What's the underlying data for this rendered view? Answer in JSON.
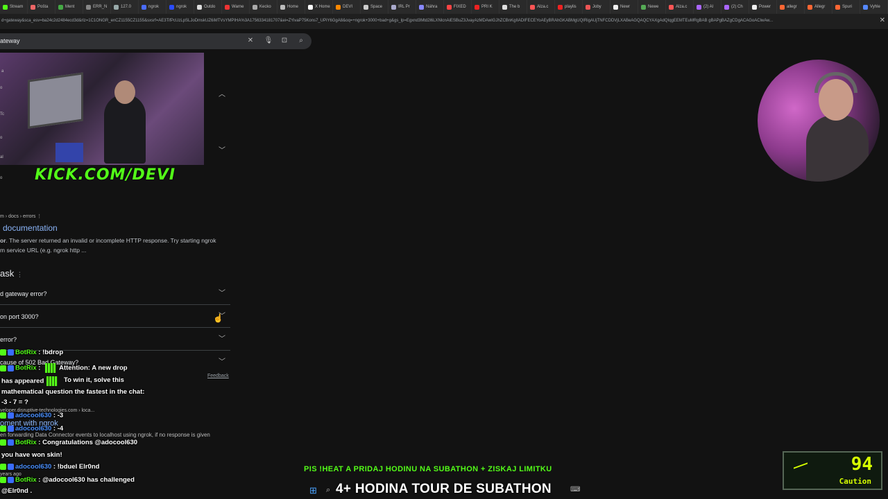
{
  "browser": {
    "tabs": [
      "Stream",
      "Pošta",
      "Ment",
      "ERR_N",
      "127.0",
      "ngrok",
      "ngrok",
      "Outdo",
      "Warne",
      "Kecko",
      "Home",
      "X Home",
      "DEVI",
      "Space",
      "IRL Pr",
      "Náhra",
      "FIXED",
      "PRI K",
      "The b",
      "Alza.c",
      "playlis",
      "Joby",
      "Newr",
      "Newe",
      "Alza.c",
      "(2) Al",
      "(2) Ch",
      "Power",
      "allegr",
      "Allegr",
      "Spuri",
      "Vyhle"
    ],
    "tab_colors": [
      "#53fc18",
      "#e66",
      "#44aa44",
      "#888",
      "#9aa",
      "#4a6cff",
      "#2a4cff",
      "#ddd",
      "#e33",
      "#aaa",
      "#bbb",
      "#fff",
      "#f80",
      "#ccc",
      "#aac",
      "#88f",
      "#f44",
      "#e22",
      "#ddd",
      "#f55",
      "#e22",
      "#e55",
      "#eee",
      "#5a5",
      "#f55",
      "#a6f",
      "#a6f",
      "#eee",
      "#f63",
      "#f63",
      "#f63",
      "#58f"
    ],
    "url": "d+gateway&sca_esv=ba24c2d2484ecd3d&rlz=1C1ONGR_enCZ1155CZ1155&sxsrf=AE3TifPcUzLpSLJoDmskUZ6iMTVsYMPIHA%3A1756334181707&ei=ZYivaP75Kons7_UPiY6GgA8&oq=+ngrok+3000+bad+g&gs_lp=Egxnd3Mtd2l6LXNlcnAiESBuZ3JvayAzMDAwIGJhZCBnKgIIADIFECEYoAEyBRAhGKABMgUQIRigAUjTNFCDDVjLXABeAGQAQCYAXgAdQIqgEEMTEuMRgBAB gBAPgBAZgCDgACAGoAClwAw..."
  },
  "search": {
    "query": "ateway"
  },
  "overlay": {
    "kick_logo": "KICK.COM/DEVI",
    "left_fragments": [
      "a",
      "o",
      "Tc",
      "o",
      "al",
      "o"
    ],
    "ticker": "PIS !HEAT A PRIDAJ HODINU NA SUBATHON + ZISKAJ LIMITKU",
    "banner": "4+ HODINA TOUR DE SUBATHON",
    "meter_value": "94",
    "meter_label": "Caution"
  },
  "result": {
    "breadcrumb": "m › docs › errors",
    "title": "documentation",
    "snippet_bold": "or",
    "snippet_1": ". The server returned an invalid or incomplete HTTP response. Try starting ngrok",
    "snippet_2": "m service URL (e.g. ngrok http ..."
  },
  "paa": {
    "heading": "ask",
    "questions": [
      "d gateway error?",
      "on port 3000?",
      "error?",
      "cause of 502 Bad Gateway?"
    ]
  },
  "feedback": "Feedback",
  "underlay": {
    "site": "veloper.disruptive-technologies.com › loca...",
    "title_frag": "oment with ngrok",
    "snippet": "en forwarding Data Connector events to localhost using ngrok, if no response is given",
    "time": "years ago"
  },
  "chat": [
    {
      "user": "BotRix",
      "sep": " : ",
      "msg": "!bdrop"
    },
    {
      "user": "BotRix",
      "sep": " : ",
      "msg": "Attention: A new drop"
    },
    {
      "user": "",
      "sep": "",
      "msg": "has appeared"
    },
    {
      "user": "",
      "sep": "",
      "msg": "To win it, solve this"
    },
    {
      "user": "",
      "sep": "",
      "msg": "mathematical question the fastest in the chat:"
    },
    {
      "user": "",
      "sep": "",
      "msg": "-3 - 7 = ?"
    },
    {
      "user": "adocool630",
      "sep": " : ",
      "msg": "-3"
    },
    {
      "user": "adocool630",
      "sep": " : ",
      "msg": "-4"
    },
    {
      "user": "BotRix",
      "sep": " : ",
      "msg": "Congratulations @adocool630"
    },
    {
      "user": "",
      "sep": "",
      "msg": "you have won skin!"
    },
    {
      "user": "adocool630",
      "sep": " : ",
      "msg": "!bduel Elr0nd"
    },
    {
      "user": "BotRix",
      "sep": " : ",
      "msg": "@adocool630 has challenged"
    },
    {
      "user": "",
      "sep": "",
      "msg": "@Elr0nd ."
    }
  ]
}
